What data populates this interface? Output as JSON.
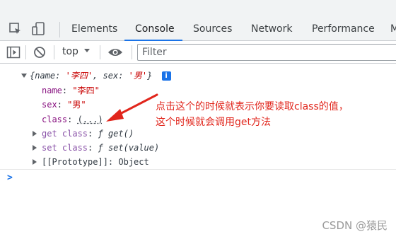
{
  "devtools": {
    "tabs": [
      {
        "label": "Elements"
      },
      {
        "label": "Console"
      },
      {
        "label": "Sources"
      },
      {
        "label": "Network"
      },
      {
        "label": "Performance"
      },
      {
        "label": "M"
      }
    ],
    "active_tab": "Console",
    "accent_color": "#1a73e8"
  },
  "toolbar": {
    "context_label": "top",
    "filter_placeholder": "Filter"
  },
  "console": {
    "summary": {
      "open_brace": "{",
      "k1": "name",
      "colon": ": ",
      "v1": "'李四'",
      "comma": ", ",
      "k2": "sex",
      "v2": "'男'",
      "close_brace": "}"
    },
    "props": [
      {
        "key": "name",
        "value": "\"李四\""
      },
      {
        "key": "sex",
        "value": "\"男\""
      },
      {
        "key": "class",
        "value": "(...)"
      }
    ],
    "accessors": [
      {
        "prefix": "get class",
        "fn": "ƒ",
        "sig": "get()"
      },
      {
        "prefix": "set class",
        "fn": "ƒ",
        "sig": "set(value)"
      }
    ],
    "prototype": {
      "key": "[[Prototype]]",
      "value": "Object"
    },
    "info_badge": "i",
    "prompt_symbol": ">"
  },
  "annotation": {
    "line1": "点击这个的时候就表示你要读取class的值，",
    "line2": "这个时候就会调用get方法",
    "color": "#e1261c"
  },
  "watermark": "CSDN @猿民"
}
